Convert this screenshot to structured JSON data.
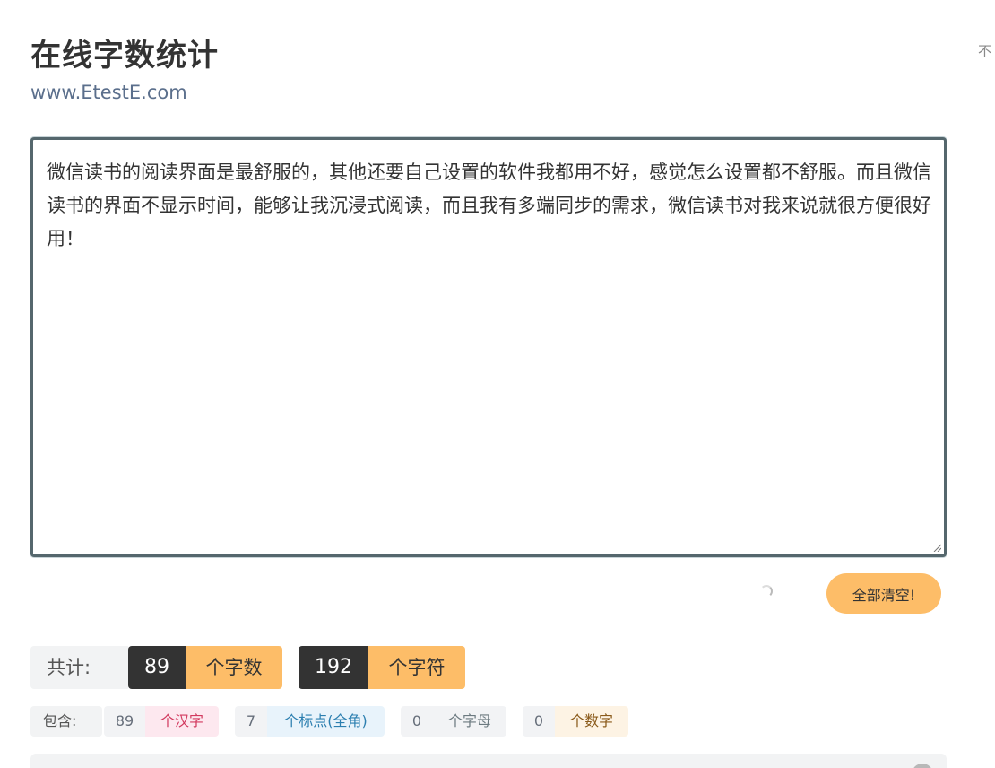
{
  "header": {
    "title": "在线字数统计",
    "url": "www.EtestE.com",
    "corner_text": "不"
  },
  "editor": {
    "content": "微信读书的阅读界面是最舒服的，其他还要自己设置的软件我都用不好，感觉怎么设置都不舒服。而且微信读书的界面不显示时间，能够让我沉浸式阅读，而且我有多端同步的需求，微信读书对我来说就很方便很好用！"
  },
  "actions": {
    "clear_label": "全部清空!"
  },
  "totals": {
    "label": "共计:",
    "words_count": "89",
    "words_unit": "个字数",
    "chars_count": "192",
    "chars_unit": "个字符"
  },
  "contains": {
    "label": "包含:",
    "hanzi_count": "89",
    "hanzi_unit": "个汉字",
    "punct_count": "7",
    "punct_unit": "个标点(全角)",
    "letter_count": "0",
    "letter_unit": "个字母",
    "digit_count": "0",
    "digit_unit": "个数字"
  },
  "colors": {
    "accent": "#fdbd68",
    "dark": "#333333",
    "editor_border": "#55676d",
    "url_color": "#5b6f8c"
  },
  "icons": {
    "spinner": "loading-spinner-icon",
    "resize": "resize-handle-icon"
  }
}
